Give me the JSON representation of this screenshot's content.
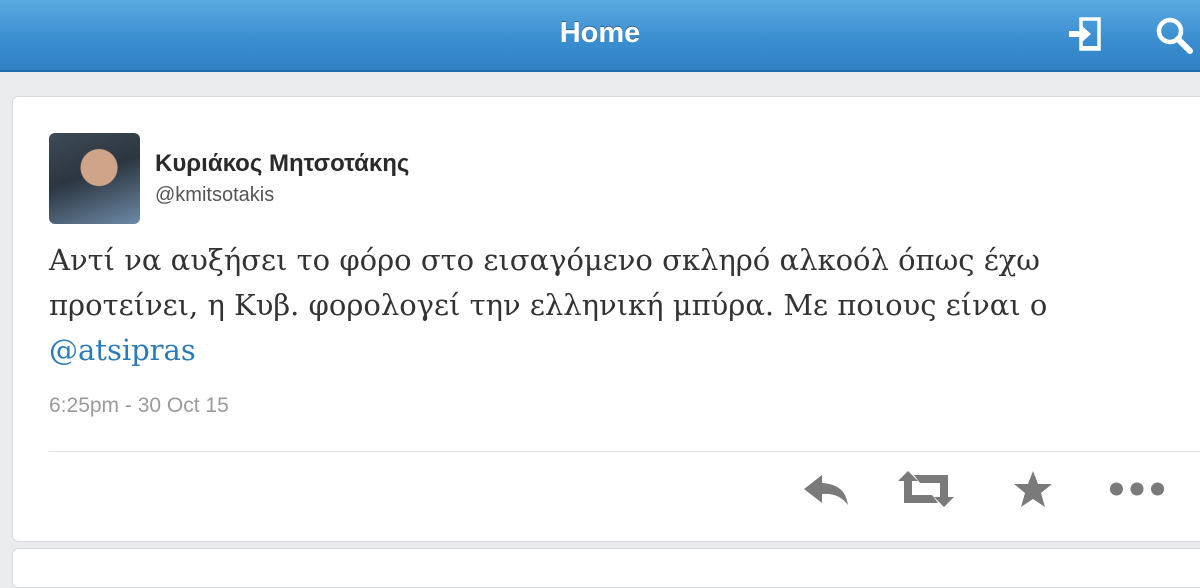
{
  "header": {
    "title": "Home",
    "icons": [
      "sign-out-icon",
      "search-icon"
    ],
    "colors": {
      "bar": "#3b8fd0",
      "title": "#ffffff"
    }
  },
  "tweet": {
    "author_name": "Κυριάκος Μητσοτάκης",
    "author_handle": "@kmitsotakis",
    "text_line1": "Αντί να αυξήσει το φόρο στο εισαγόμενο σκληρό αλκοόλ όπως έχω",
    "text_line2": "προτείνει, η Κυβ. φορολογεί την ελληνική μπύρα. Με ποιους είναι ο",
    "mention": "@atsipras",
    "timestamp": "6:25pm - 30 Oct 15",
    "actions": [
      "reply-icon",
      "retweet-icon",
      "favorite-star-icon",
      "more-icon"
    ],
    "colors": {
      "mention": "#2b7bb9",
      "text": "#333333",
      "meta": "#9a9a9a",
      "icon": "#7a7a7a"
    }
  }
}
